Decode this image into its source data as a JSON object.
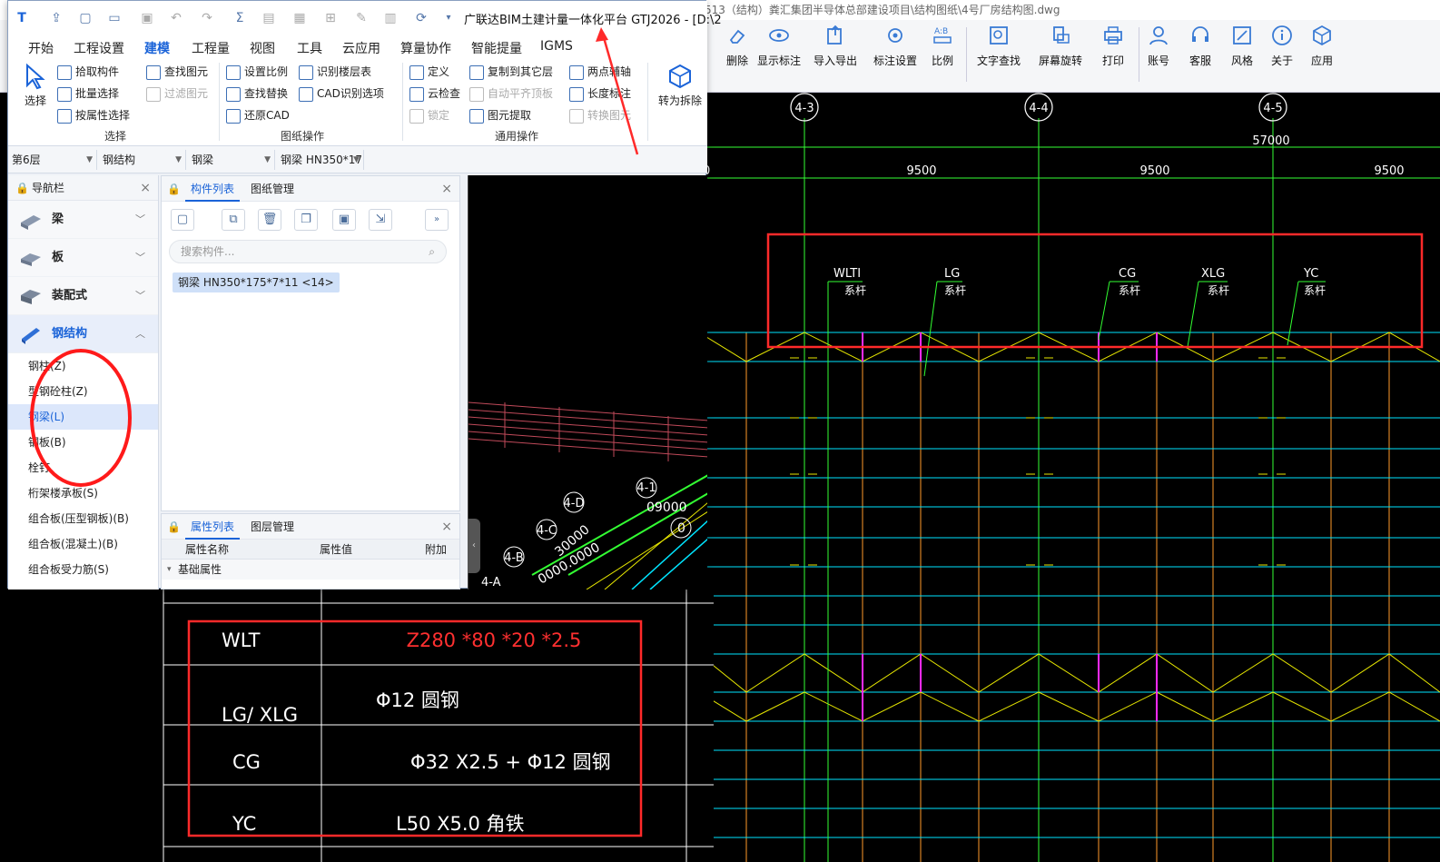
{
  "bg_window": {
    "title": "513（结构）粪汇集团半导体总部建设项目\\结构图纸\\4号厂房结构图.dwg"
  },
  "cad_ribbon": {
    "buttons": [
      "删除",
      "显示标注",
      "导入导出",
      "标注设置",
      "比例",
      "文字查找",
      "屏幕旋转",
      "打印",
      "账号",
      "客服",
      "风格",
      "关于",
      "应用"
    ]
  },
  "gtj": {
    "title": "广联达BIM土建计量一体化平台 GTJ2026 - [D:\\2",
    "tabs": [
      "开始",
      "工程设置",
      "建模",
      "工程量",
      "视图",
      "工具",
      "云应用",
      "算量协作",
      "智能提量",
      "IGMS"
    ],
    "active_tab": "建模",
    "ribbon": {
      "select_label": "选择",
      "pick": "拾取构件",
      "batch": "批量选择",
      "by_attr": "按属性选择",
      "find_elem": "查找图元",
      "filter_elem": "过滤图元",
      "set_scale": "设置比例",
      "recognize_floor": "识别楼层表",
      "find_replace": "查找替换",
      "cad_options": "CAD识别选项",
      "restore_cad": "还原CAD",
      "define": "定义",
      "copy_floor": "复制到其它层",
      "two_axis": "两点辅轴",
      "cloud_check": "云检查",
      "auto_flat": "自动平齐顶板",
      "length_mark": "长度标注",
      "lock": "锁定",
      "extract": "图元提取",
      "convert": "转换图元",
      "convert_disassemble": "转为拆除",
      "group_select": "选择",
      "group_drawing": "图纸操作",
      "group_general": "通用操作"
    },
    "filters": [
      "第6层",
      "钢结构",
      "钢梁",
      "钢梁 HN350*17"
    ],
    "nav": {
      "title": "导航栏",
      "categories": [
        "梁",
        "板",
        "装配式",
        "钢结构"
      ],
      "sub_items": [
        "钢柱(Z)",
        "型钢砼柱(Z)",
        "钢梁(L)",
        "钢板(B)",
        "栓钉",
        "桁架楼承板(S)",
        "组合板(压型钢板)(B)",
        "组合板(混凝土)(B)",
        "组合板受力筋(S)"
      ],
      "selected": "钢梁(L)"
    },
    "component": {
      "tab_list": "构件列表",
      "tab_drawing": "图纸管理",
      "search_placeholder": "搜索构件...",
      "item": "钢梁 HN350*175*7*11 <14>"
    },
    "properties": {
      "tab_list": "属性列表",
      "tab_layer": "图层管理",
      "col_name": "属性名称",
      "col_value": "属性值",
      "col_extra": "附加",
      "row_basic": "基础属性"
    },
    "preview_labels": [
      "4-1",
      "4-D",
      "4-C",
      "4-B",
      "4-A",
      "09000",
      "0",
      "30000",
      "0000.0000"
    ]
  },
  "cad": {
    "axes": [
      "4-3",
      "4-4",
      "4-5"
    ],
    "dim_total": "57000",
    "dims": [
      "9500",
      "9500",
      "9500"
    ],
    "tags": [
      "WLTI",
      "LG",
      "CG",
      "XLG",
      "YC"
    ],
    "tag_sub": "系杆"
  },
  "legend_table": {
    "rows": [
      {
        "code": "WLT",
        "spec": "Z280 *80 *20 *2.5"
      },
      {
        "code": "LG/ XLG",
        "spec": "Φ12 圆钢"
      },
      {
        "code": "CG",
        "spec": "Φ32 X2.5 + Φ12 圆钢"
      },
      {
        "code": "YC",
        "spec": "L50 X5.0 角铁"
      }
    ]
  },
  "colors": {
    "accent": "#1a63d8",
    "annotation_red": "#ff2a2a",
    "cad_cyan": "#00e5ff",
    "cad_yellow": "#e8e800",
    "cad_green": "#33ff33",
    "cad_orange": "#ff9a2a",
    "cad_magenta": "#ff2aff"
  }
}
